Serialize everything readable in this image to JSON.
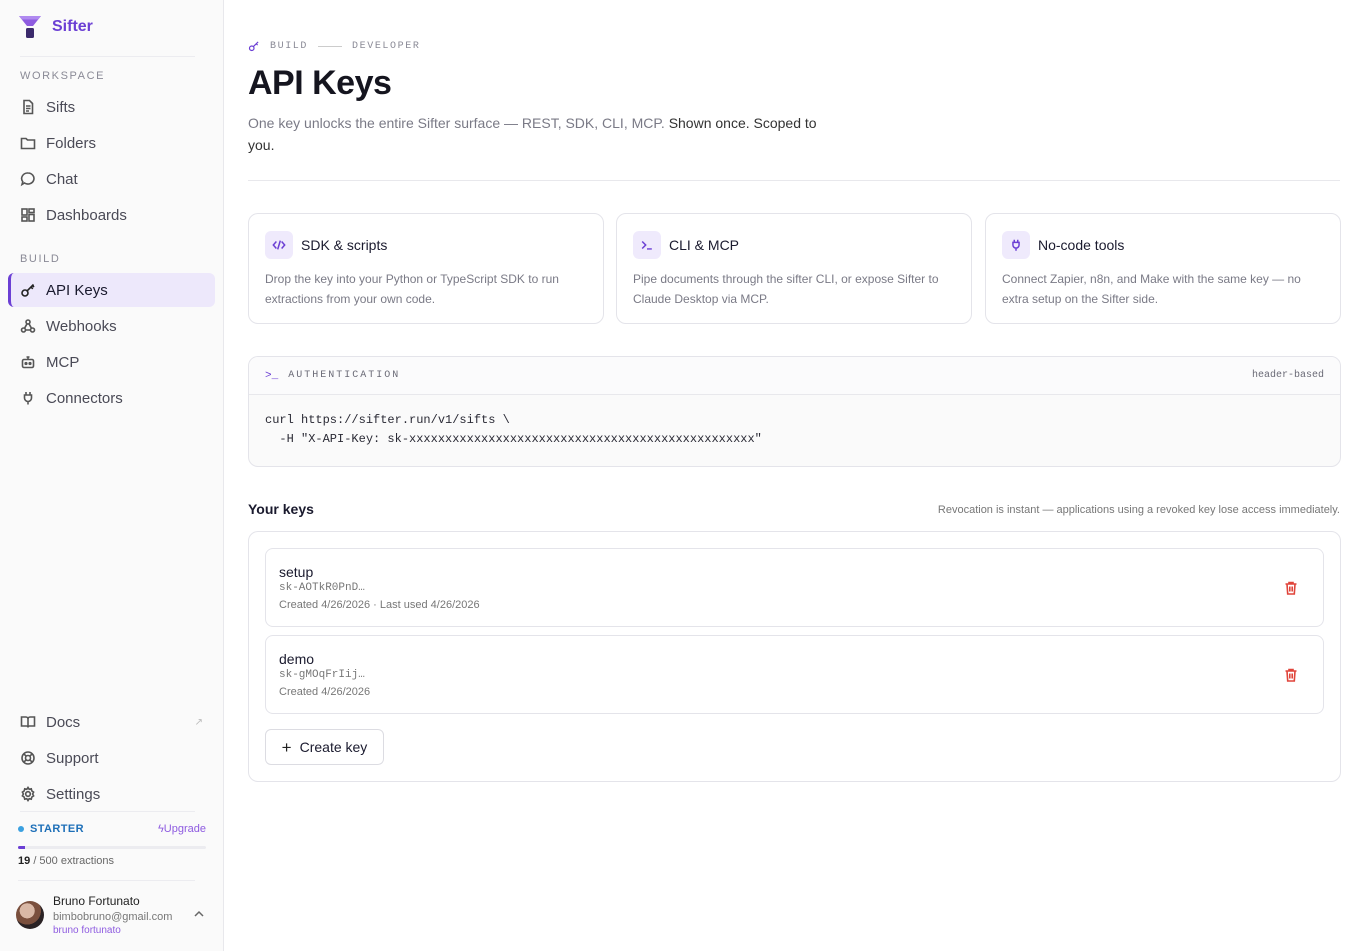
{
  "brand": {
    "name": "Sifter"
  },
  "sidebar": {
    "workspace_label": "WORKSPACE",
    "workspace_items": [
      {
        "label": "Sifts",
        "icon": "file-text-icon"
      },
      {
        "label": "Folders",
        "icon": "folder-icon"
      },
      {
        "label": "Chat",
        "icon": "chat-bubble-icon"
      },
      {
        "label": "Dashboards",
        "icon": "grid-icon"
      }
    ],
    "build_label": "BUILD",
    "build_items": [
      {
        "label": "API Keys",
        "icon": "key-icon",
        "active": true
      },
      {
        "label": "Webhooks",
        "icon": "webhook-icon"
      },
      {
        "label": "MCP",
        "icon": "robot-icon"
      },
      {
        "label": "Connectors",
        "icon": "plug-icon"
      }
    ],
    "footer_items": [
      {
        "label": "Docs",
        "icon": "book-icon",
        "external": "↗"
      },
      {
        "label": "Support",
        "icon": "lifebuoy-icon"
      },
      {
        "label": "Settings",
        "icon": "gear-icon"
      }
    ],
    "plan": {
      "name": "STARTER",
      "upgrade_label": "Upgrade",
      "used": "19",
      "usage_suffix": "/ 500 extractions",
      "usage_fraction": 0.038
    },
    "user": {
      "name": "Bruno Fortunato",
      "email": "bimbobruno@gmail.com",
      "handle": "bruno fortunato"
    }
  },
  "header": {
    "breadcrumb": [
      "BUILD",
      "DEVELOPER"
    ],
    "title": "API Keys",
    "subtitle_muted": "One key unlocks the entire Sifter surface — REST, SDK, CLI, MCP. ",
    "subtitle_dark": "Shown once. Scoped to you."
  },
  "cards": [
    {
      "title": "SDK & scripts",
      "icon": "code-icon",
      "description": "Drop the key into your Python or TypeScript SDK to run extractions from your own code."
    },
    {
      "title": "CLI & MCP",
      "icon": "terminal-icon",
      "description": "Pipe documents through the sifter CLI, or expose Sifter to Claude Desktop via MCP."
    },
    {
      "title": "No-code tools",
      "icon": "plug-icon",
      "description": "Connect Zapier, n8n, and Make with the same key — no extra setup on the Sifter side."
    }
  ],
  "auth": {
    "label": "AUTHENTICATION",
    "meta": "header-based",
    "code": "curl https://sifter.run/v1/sifts \\\n  -H \"X-API-Key: sk-xxxxxxxxxxxxxxxxxxxxxxxxxxxxxxxxxxxxxxxxxxxxxxxx\""
  },
  "keys": {
    "title": "Your keys",
    "note": "Revocation is instant — applications using a revoked key lose access immediately.",
    "items": [
      {
        "name": "setup",
        "token": "sk-AOTkR0PnD…",
        "meta": "Created 4/26/2026 · Last used 4/26/2026"
      },
      {
        "name": "demo",
        "token": "sk-gMOqFrIij…",
        "meta": "Created 4/26/2026"
      }
    ],
    "create_label": "Create key"
  },
  "colors": {
    "accent": "#6b3fd4",
    "danger": "#e0443a",
    "plan": "#1d6fb8"
  }
}
